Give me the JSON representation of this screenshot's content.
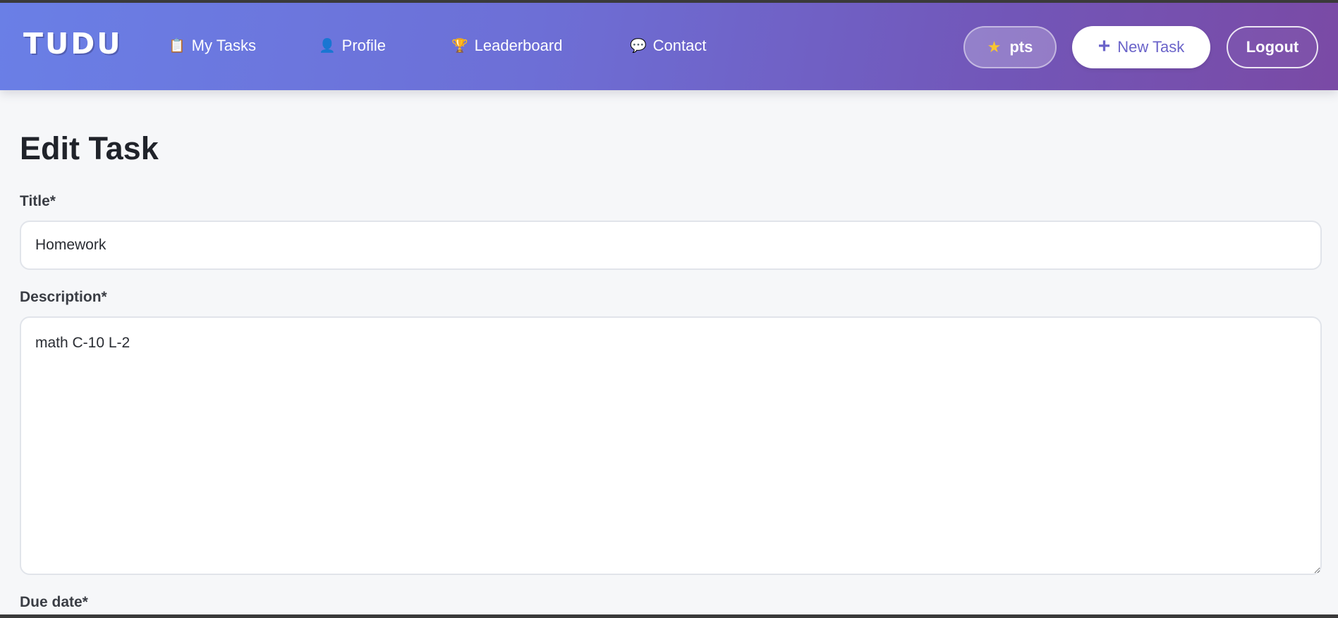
{
  "header": {
    "logo": "TUDU",
    "nav": [
      {
        "icon": "clipboard-icon",
        "glyph": "📋",
        "label": "My Tasks"
      },
      {
        "icon": "user-icon",
        "glyph": "👤",
        "label": "Profile"
      },
      {
        "icon": "trophy-icon",
        "glyph": "🏆",
        "label": "Leaderboard"
      },
      {
        "icon": "speech-bubble-icon",
        "glyph": "💬",
        "label": "Contact"
      }
    ],
    "points": {
      "icon": "star-icon",
      "glyph": "★",
      "label": "pts"
    },
    "new_task": {
      "icon": "plus-icon",
      "glyph": "+",
      "label": "New Task"
    },
    "logout": "Logout",
    "colors": {
      "gradient_start": "#6a7fe6",
      "gradient_end": "#7a4aa5",
      "accent": "#6a63c9"
    }
  },
  "form": {
    "heading": "Edit Task",
    "title": {
      "label": "Title*",
      "value": "Homework"
    },
    "description": {
      "label": "Description*",
      "value": "math C-10 L-2"
    },
    "due_date": {
      "label": "Due date*"
    }
  }
}
